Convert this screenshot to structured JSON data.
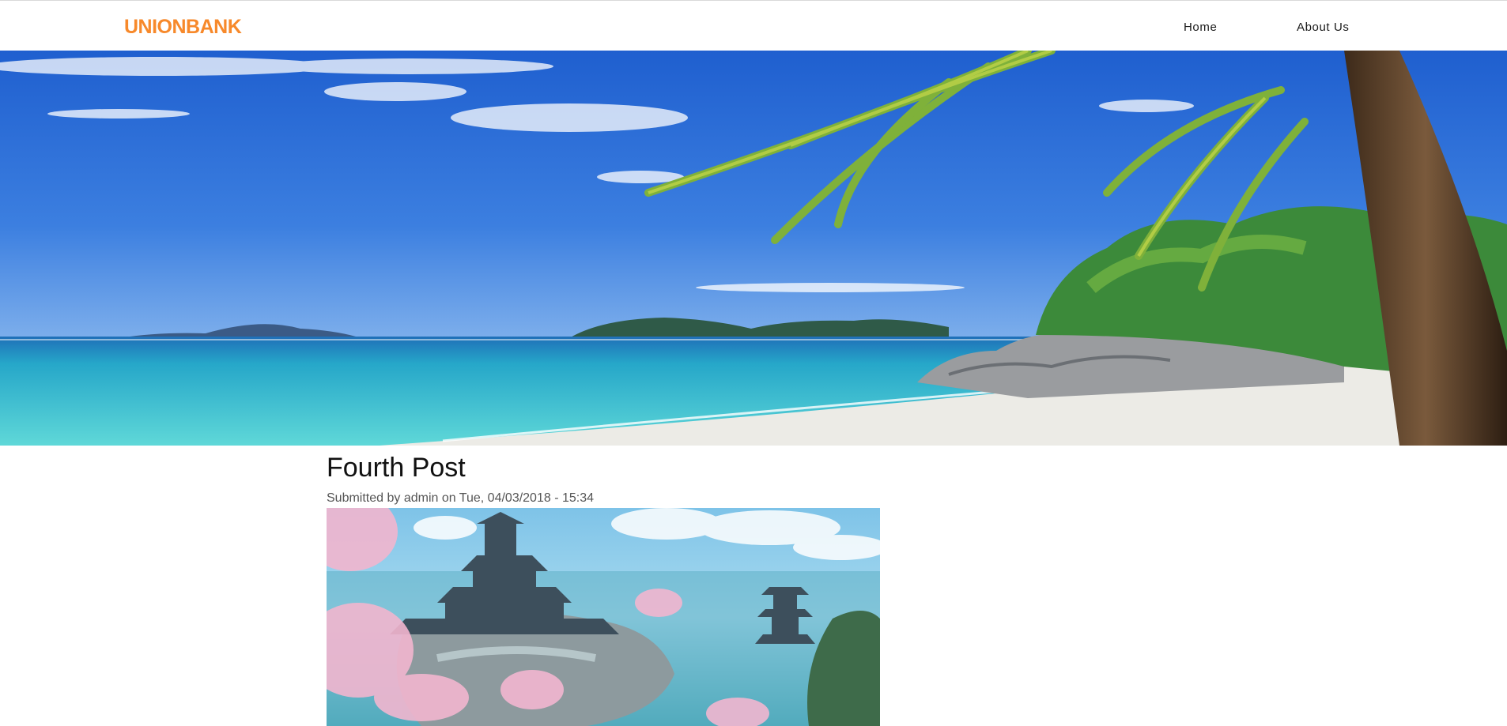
{
  "header": {
    "logo_text": "UNIONBANK",
    "nav": [
      {
        "label": "Home"
      },
      {
        "label": "About Us"
      }
    ]
  },
  "colors": {
    "brand": "#f7892b",
    "sky": "#2a6fd6",
    "sea": "#2fc6d3",
    "sand": "#ecebe6"
  },
  "hero": {
    "image": "tropical-beach-banner"
  },
  "post": {
    "title": "Fourth Post",
    "meta": "Submitted by admin on Tue, 04/03/2018 - 15:34",
    "image": "floating-castle-illustration"
  }
}
